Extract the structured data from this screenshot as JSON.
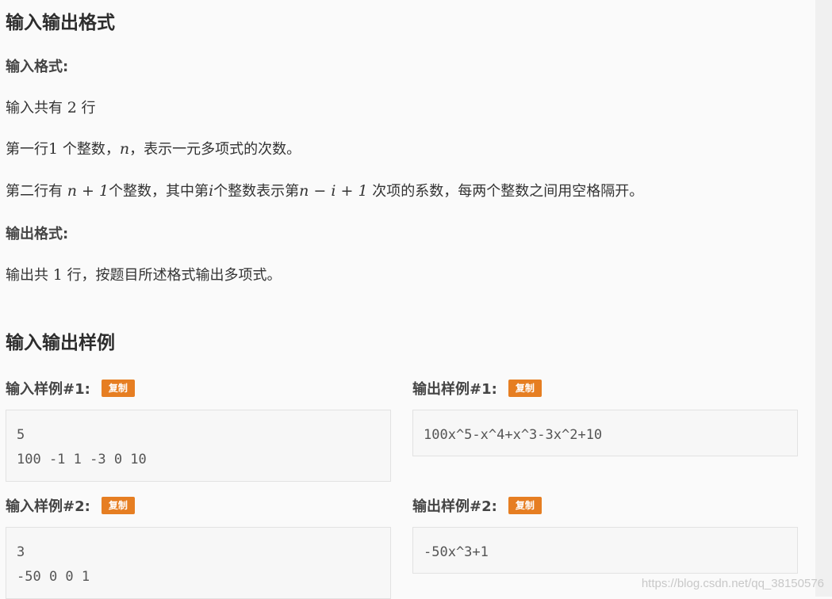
{
  "section_io_format": {
    "title": "输入输出格式",
    "input_heading": "输入格式:",
    "input_lines": {
      "l1_pre": "输入共有 ",
      "l1_num": "2",
      "l1_post": " 行",
      "l2_pre": "第一行",
      "l2_num": "1",
      "l2_mid": " 个整数，",
      "l2_var": "n",
      "l2_post": "，表示一元多项式的次数。",
      "l3_pre": "第二行有 ",
      "l3_expr": "n + 1",
      "l3_mid": "个整数，其中第",
      "l3_var_i": "i",
      "l3_mid2": "个整数表示第",
      "l3_expr2": "n − i + 1",
      "l3_post": " 次项的系数，每两个整数之间用空格隔开。"
    },
    "output_heading": "输出格式:",
    "output_lines": {
      "l1_pre": "输出共 ",
      "l1_num": "1",
      "l1_post": " 行，按题目所述格式输出多项式。"
    }
  },
  "section_samples": {
    "title": "输入输出样例",
    "copy_label": "复制",
    "samples": [
      {
        "input_title": "输入样例#1:",
        "input_lines": [
          "5",
          "100 -1 1 -3 0 10"
        ],
        "output_title": "输出样例#1:",
        "output_lines": [
          "100x^5-x^4+x^3-3x^2+10"
        ]
      },
      {
        "input_title": "输入样例#2:",
        "input_lines": [
          "3",
          "-50 0 0 1"
        ],
        "output_title": "输出样例#2:",
        "output_lines": [
          "-50x^3+1"
        ]
      }
    ]
  },
  "watermark": "https://blog.csdn.net/qq_38150576",
  "colors": {
    "copy_button": "#e67e22",
    "background": "#fafafa",
    "code_box": "#f7f7f7"
  }
}
